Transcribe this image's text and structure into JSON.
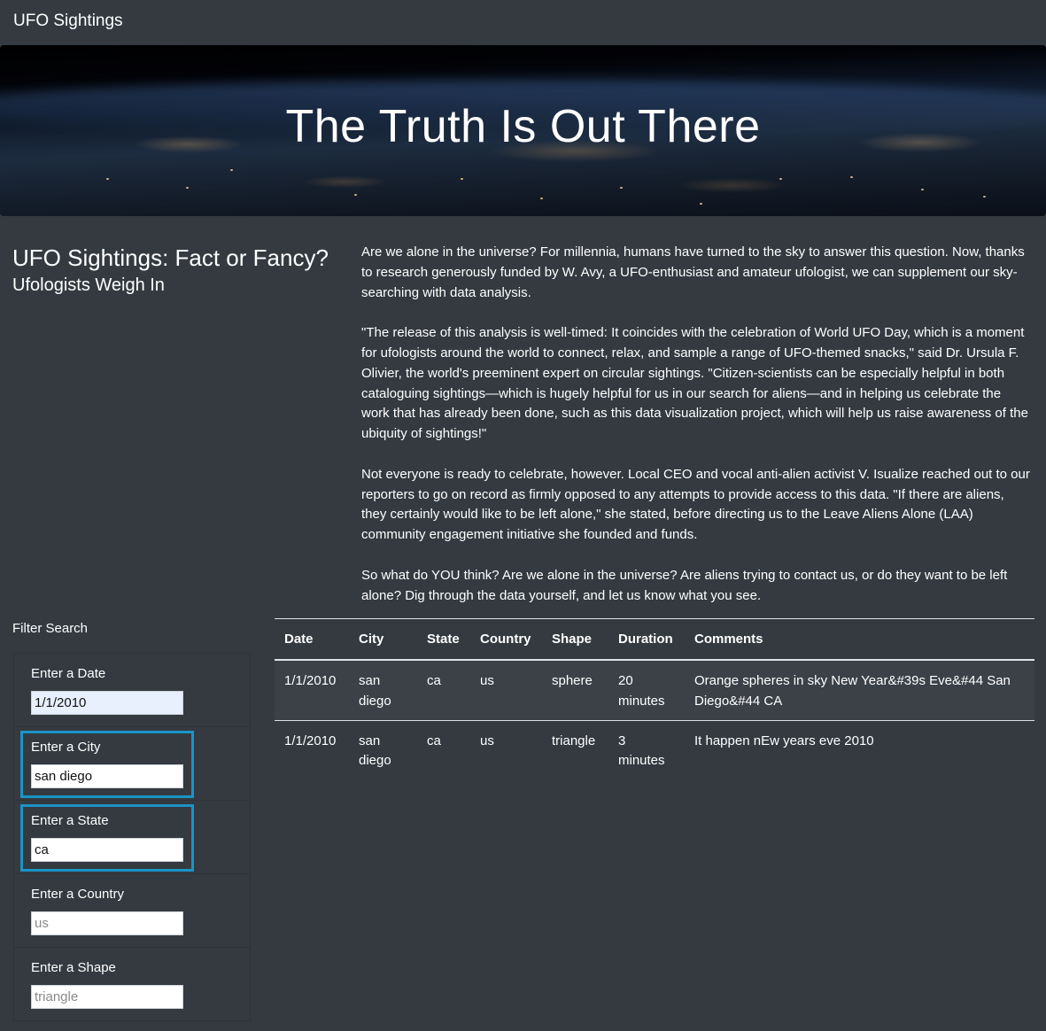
{
  "navbar": {
    "brand": "UFO Sightings"
  },
  "hero": {
    "title": "The Truth Is Out There"
  },
  "headline": {
    "title": "UFO Sightings: Fact or Fancy?",
    "subtitle": "Ufologists Weigh In"
  },
  "article": {
    "paragraphs": [
      "Are we alone in the universe? For millennia, humans have turned to the sky to answer this question. Now, thanks to research generously funded by W. Avy, a UFO-enthusiast and amateur ufologist, we can supplement our sky-searching with data analysis.",
      "\"The release of this analysis is well-timed: It coincides with the celebration of World UFO Day, which is a moment for ufologists around the world to connect, relax, and sample a range of UFO-themed snacks,\" said Dr. Ursula F. Olivier, the world's preeminent expert on circular sightings. \"Citizen-scientists can be especially helpful in both cataloguing sightings—which is hugely helpful for us in our search for aliens—and in helping us celebrate the work that has already been done, such as this data visualization project, which will help us raise awareness of the ubiquity of sightings!\"",
      "Not everyone is ready to celebrate, however. Local CEO and vocal anti-alien activist V. Isualize reached out to our reporters to go on record as firmly opposed to any attempts to provide access to this data. \"If there are aliens, they certainly would like to be left alone,\" she stated, before directing us to the Leave Aliens Alone (LAA) community engagement initiative she founded and funds.",
      "So what do YOU think? Are we alone in the universe? Are aliens trying to contact us, or do they want to be left alone? Dig through the data yourself, and let us know what you see."
    ]
  },
  "filters": {
    "heading": "Filter Search",
    "date": {
      "label": "Enter a Date",
      "value": "1/1/2010",
      "placeholder": ""
    },
    "city": {
      "label": "Enter a City",
      "value": "san diego",
      "placeholder": ""
    },
    "state": {
      "label": "Enter a State",
      "value": "ca",
      "placeholder": ""
    },
    "country": {
      "label": "Enter a Country",
      "value": "",
      "placeholder": "us"
    },
    "shape": {
      "label": "Enter a Shape",
      "value": "",
      "placeholder": "triangle"
    }
  },
  "table": {
    "headers": [
      "Date",
      "City",
      "State",
      "Country",
      "Shape",
      "Duration",
      "Comments"
    ],
    "rows": [
      [
        "1/1/2010",
        "san diego",
        "ca",
        "us",
        "sphere",
        "20 minutes",
        "Orange spheres in sky New Year&#39s Eve&#44 San Diego&#44 CA"
      ],
      [
        "1/1/2010",
        "san diego",
        "ca",
        "us",
        "triangle",
        "3 minutes",
        "It happen nEw years eve 2010"
      ]
    ]
  }
}
